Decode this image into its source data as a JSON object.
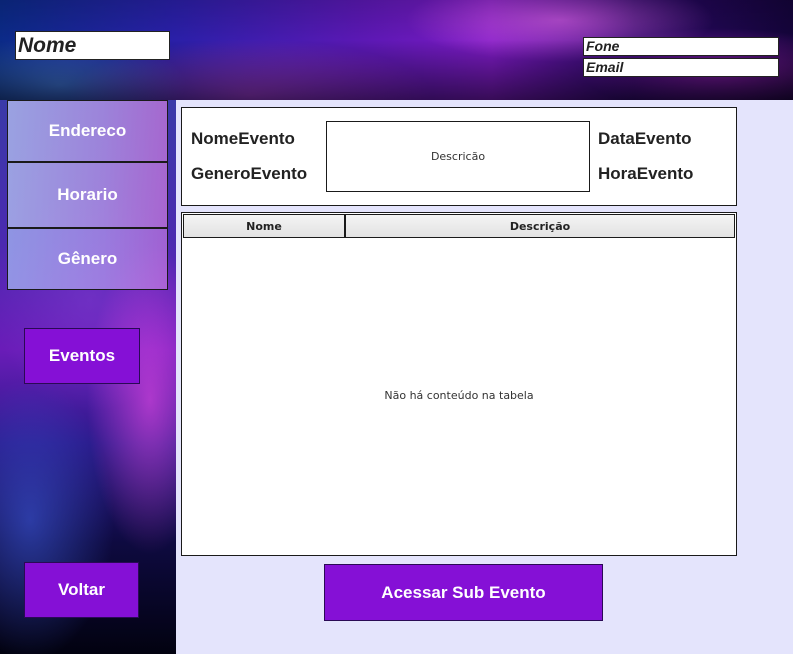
{
  "header": {
    "nome": "Nome",
    "fone": "Fone",
    "email": "Email"
  },
  "sidebar": {
    "items": [
      {
        "label": "Endereco"
      },
      {
        "label": "Horario"
      },
      {
        "label": "Gênero"
      }
    ],
    "eventos_label": "Eventos",
    "voltar_label": "Voltar"
  },
  "event_info": {
    "nome_label": "NomeEvento",
    "genero_label": "GeneroEvento",
    "descricao_placeholder": "Descricão",
    "data_label": "DataEvento",
    "hora_label": "HoraEvento"
  },
  "table": {
    "columns": [
      "Nome",
      "Descrição"
    ],
    "empty_message": "Não há conteúdo na tabela"
  },
  "footer": {
    "sub_event_label": "Acessar Sub Evento"
  },
  "colors": {
    "button_purple": "#8510d6",
    "content_background": "#e4e4fc"
  }
}
